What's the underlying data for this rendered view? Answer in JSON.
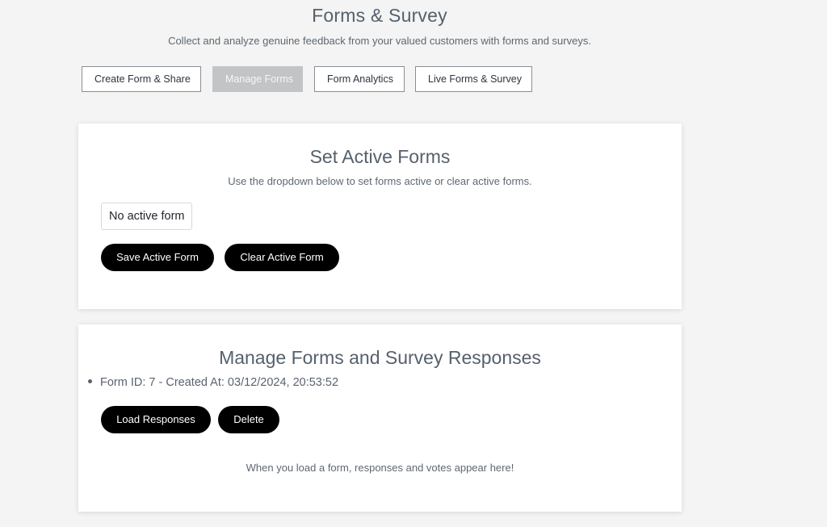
{
  "header": {
    "title": "Forms & Survey",
    "subtitle": "Collect and analyze genuine feedback from your valued customers with forms and surveys."
  },
  "tabs": [
    {
      "label": "Create Form & Share",
      "active": false
    },
    {
      "label": "Manage Forms",
      "active": true
    },
    {
      "label": "Form Analytics",
      "active": false
    },
    {
      "label": "Live Forms & Survey",
      "active": false
    }
  ],
  "active_forms": {
    "title": "Set Active Forms",
    "description": "Use the dropdown below to set forms active or clear active forms.",
    "dropdown_value": "No active form",
    "save_label": "Save Active Form",
    "clear_label": "Clear Active Form"
  },
  "manage": {
    "title": "Manage Forms and Survey Responses",
    "forms": [
      {
        "text": "Form ID: 7 - Created At: 03/12/2024, 20:53:52"
      }
    ],
    "load_label": "Load Responses",
    "delete_label": "Delete",
    "empty_note": "When you load a form, responses and votes appear here!"
  },
  "colors": {
    "background": "#f3f4f3",
    "active_tab": "#c3c4c6",
    "primary_button": "#000000"
  }
}
